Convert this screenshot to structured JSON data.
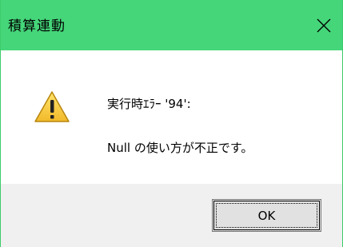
{
  "window": {
    "title": "積算連動",
    "title_bar_color": "#45d67a",
    "close_icon": "close-icon"
  },
  "message": {
    "icon": "warning-icon",
    "line1": "実行時ｴﾗｰ '94':",
    "line2": "Null の使い方が不正です。"
  },
  "buttons": {
    "ok_label": "OK"
  }
}
